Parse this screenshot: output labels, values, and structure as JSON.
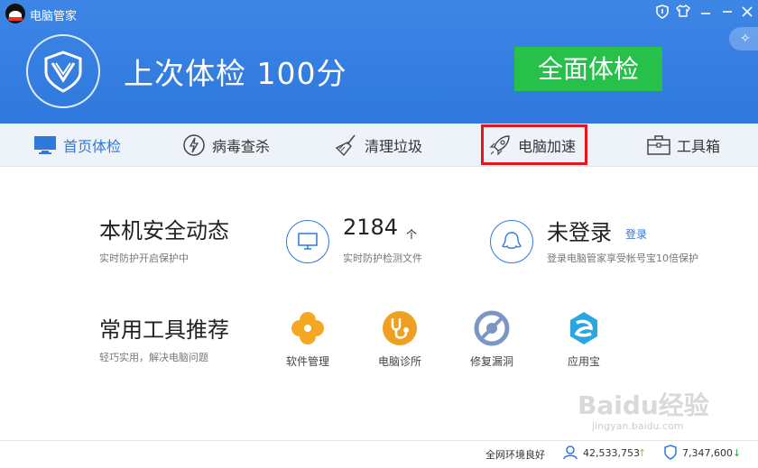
{
  "window": {
    "title": "电脑管家",
    "controls": [
      "shield-icon",
      "shirt-icon",
      "minimize-icon",
      "close-icon"
    ]
  },
  "header": {
    "headline": "上次体检 100分",
    "scan_button": "全面体检",
    "sparkle_icon": "sparkle-icon"
  },
  "nav": {
    "items": [
      {
        "label": "首页体检",
        "icon": "monitor-icon",
        "active": true
      },
      {
        "label": "病毒查杀",
        "icon": "lightning-icon",
        "active": false
      },
      {
        "label": "清理垃圾",
        "icon": "broom-icon",
        "active": false
      },
      {
        "label": "电脑加速",
        "icon": "rocket-icon",
        "active": false,
        "highlighted": true
      },
      {
        "label": "工具箱",
        "icon": "toolbox-icon",
        "active": false
      }
    ]
  },
  "security": {
    "title": "本机安全动态",
    "subtitle": "实时防护开启保护中",
    "files_count": "2184",
    "files_unit": "个",
    "files_caption": "实时防护检测文件",
    "login_title": "未登录",
    "login_link": "登录",
    "login_caption": "登录电脑管家享受帐号宝10倍保护"
  },
  "tools": {
    "title": "常用工具推荐",
    "subtitle": "轻巧实用，解决电脑问题",
    "items": [
      {
        "label": "软件管理",
        "icon": "clover-icon"
      },
      {
        "label": "电脑诊所",
        "icon": "stethoscope-icon"
      },
      {
        "label": "修复漏洞",
        "icon": "repair-icon"
      },
      {
        "label": "应用宝",
        "icon": "app-store-icon"
      }
    ]
  },
  "status": {
    "network": "全网环境良好",
    "count1": "42,533,753",
    "count2": "7,347,600"
  },
  "watermark": {
    "text": "Baidu经验",
    "sub": "jingyan.baidu.com"
  },
  "colors": {
    "header_blue": "#3d86e6",
    "scan_green": "#26c04a",
    "accent": "#2f78dd",
    "highlight_red": "#e4151b",
    "up_arrow": "#f0a020",
    "down_arrow": "#2aa84a"
  }
}
